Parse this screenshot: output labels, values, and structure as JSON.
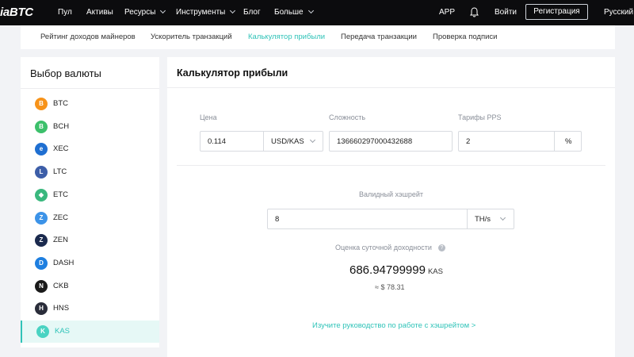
{
  "topnav": {
    "logo": "iaBTC",
    "items": [
      "Пул",
      "Активы",
      "Ресурсы",
      "Инструменты",
      "Блог",
      "Больше"
    ],
    "app": "APP",
    "login": "Войти",
    "register": "Регистрация",
    "language": "Русский"
  },
  "subtabs": [
    "Рейтинг доходов майнеров",
    "Ускоритель транзакций",
    "Калькулятор прибыли",
    "Передача транзакции",
    "Проверка подписи"
  ],
  "sidebar": {
    "title": "Выбор валюты",
    "coins": [
      {
        "label": "BTC",
        "color": "#f7931a",
        "glyph": "B"
      },
      {
        "label": "BCH",
        "color": "#3cc06b",
        "glyph": "B"
      },
      {
        "label": "XEC",
        "color": "#1f6fd1",
        "glyph": "e"
      },
      {
        "label": "LTC",
        "color": "#3d5ea8",
        "glyph": "L"
      },
      {
        "label": "ETC",
        "color": "#3ab87e",
        "glyph": "◆"
      },
      {
        "label": "ZEC",
        "color": "#3c93e8",
        "glyph": "Z"
      },
      {
        "label": "ZEN",
        "color": "#1b2a4e",
        "glyph": "Z"
      },
      {
        "label": "DASH",
        "color": "#1e7fe0",
        "glyph": "D"
      },
      {
        "label": "CKB",
        "color": "#1a1a1a",
        "glyph": "N"
      },
      {
        "label": "HNS",
        "color": "#2a2d3a",
        "glyph": "H"
      },
      {
        "label": "KAS",
        "color": "#49d3c2",
        "glyph": "K"
      }
    ]
  },
  "main": {
    "title": "Калькулятор прибыли",
    "price_label": "Цена",
    "price_value": "0.114",
    "price_unit": "USD/KAS",
    "difficulty_label": "Сложность",
    "difficulty_value": "136660297000432688",
    "pps_label": "Тарифы PPS",
    "pps_value": "2",
    "pps_unit": "%",
    "hashrate_label": "Валидный хэшрейт",
    "hashrate_value": "8",
    "hashrate_unit": "TH/s",
    "estimate_label": "Оценка суточной доходности",
    "help": "?",
    "result_value": "686.94799999",
    "result_unit": "KAS",
    "usd_value": "≈ $ 78.31",
    "guide_link": "Изучите руководство по работе с хэшрейтом >"
  },
  "colors": {
    "accent": "#2fc3b8",
    "nav_bg": "#0c0c0e"
  }
}
